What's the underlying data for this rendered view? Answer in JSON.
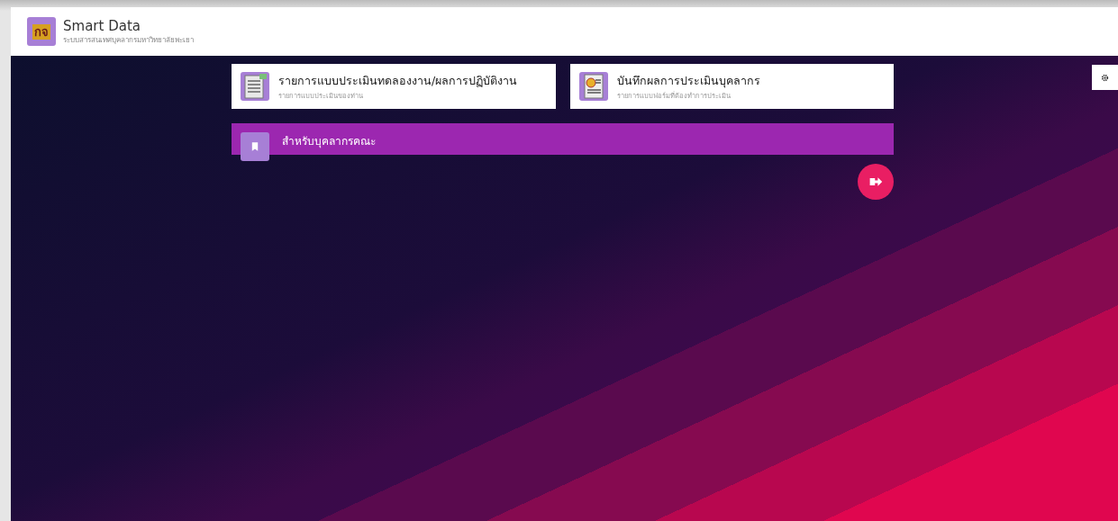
{
  "header": {
    "logo_text": "กจ",
    "title": "Smart Data",
    "subtitle": "ระบบสารสนเทศบุคลากรมหาวิทยาลัยพะเยา"
  },
  "cards": [
    {
      "kind": "document",
      "title": "รายการแบบประเมินทดลองงาน/ผลการปฏิบัติงาน",
      "subtitle": "รายการแบบประเมินของท่าน"
    },
    {
      "kind": "certificate",
      "title": "บันทึกผลการประเมินบุคลากร",
      "subtitle": "รายการแบบฟอร์มที่ต้องทำการประเมิน"
    }
  ],
  "section": {
    "title": "สำหรับบุคลากรคณะ"
  }
}
